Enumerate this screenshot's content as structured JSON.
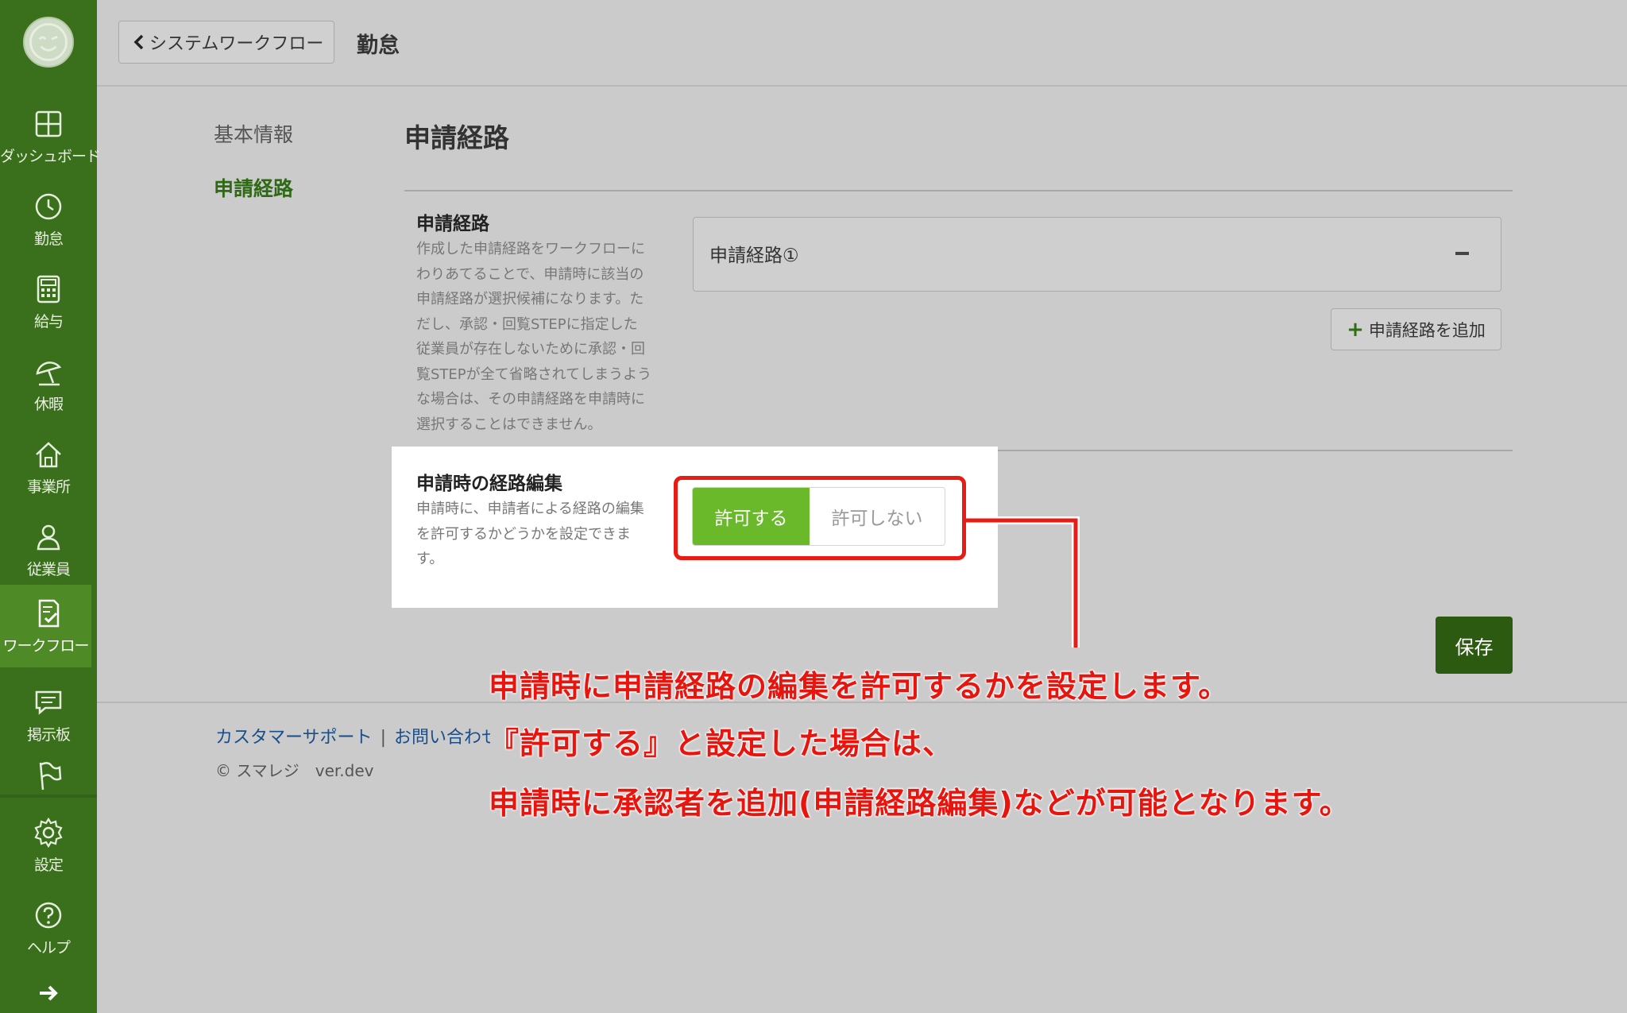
{
  "sidebar": {
    "items": [
      {
        "label": "ダッシュボード",
        "icon": "dashboard-icon"
      },
      {
        "label": "勤怠",
        "icon": "clock-icon"
      },
      {
        "label": "給与",
        "icon": "calculator-icon"
      },
      {
        "label": "休暇",
        "icon": "beach-umbrella-icon"
      },
      {
        "label": "事業所",
        "icon": "home-icon"
      },
      {
        "label": "従業員",
        "icon": "person-icon"
      },
      {
        "label": "ワークフロー",
        "icon": "checklist-icon"
      },
      {
        "label": "掲示板",
        "icon": "chat-icon"
      },
      {
        "label": "",
        "icon": "flag-icon"
      },
      {
        "label": "設定",
        "icon": "gear-icon"
      },
      {
        "label": "ヘルプ",
        "icon": "help-icon"
      }
    ],
    "active_item": "ワークフロー"
  },
  "header": {
    "back_label": "システムワークフロー",
    "title": "勤怠"
  },
  "subnav": {
    "items": [
      "基本情報",
      "申請経路"
    ],
    "active": "申請経路"
  },
  "section": {
    "title": "申請経路"
  },
  "route_field": {
    "title": "申請経路",
    "desc_lines": [
      "作成した申請経路をワークフローに",
      "わりあてることで、申請時に該当の",
      "申請経路が選択候補になります。た",
      "だし、承認・回覧STEPに指定した",
      "従業員が存在しないために承認・回",
      "覧STEPが全て省略されてしまうよう",
      "な場合は、その申請経路を申請時に",
      "選択することはできません。"
    ],
    "route_name": "申請経路①",
    "add_label": "申請経路を追加"
  },
  "edit_field": {
    "title": "申請時の経路編集",
    "desc_lines": [
      "申請時に、申請者による経路の編集",
      "を許可するかどうかを設定できま",
      "す。"
    ],
    "allow_label": "許可する",
    "deny_label": "許可しない",
    "selected": "許可する"
  },
  "save_label": "保存",
  "footer": {
    "support_link": "カスタマーサポート",
    "contact_link": "お問い合わせ",
    "copyright": "© スマレジ　ver.dev"
  },
  "annotation": {
    "lines": [
      "申請時に申請経路の編集を許可するかを設定します。",
      "『許可する』と設定した場合は、",
      "申請時に承認者を追加(申請経路編集)などが可能となります。"
    ],
    "color": "#e8150e"
  },
  "colors": {
    "sidebar": "#3a6f1c",
    "accent_green": "#6ab92a",
    "save_button": "#2d5a11"
  }
}
